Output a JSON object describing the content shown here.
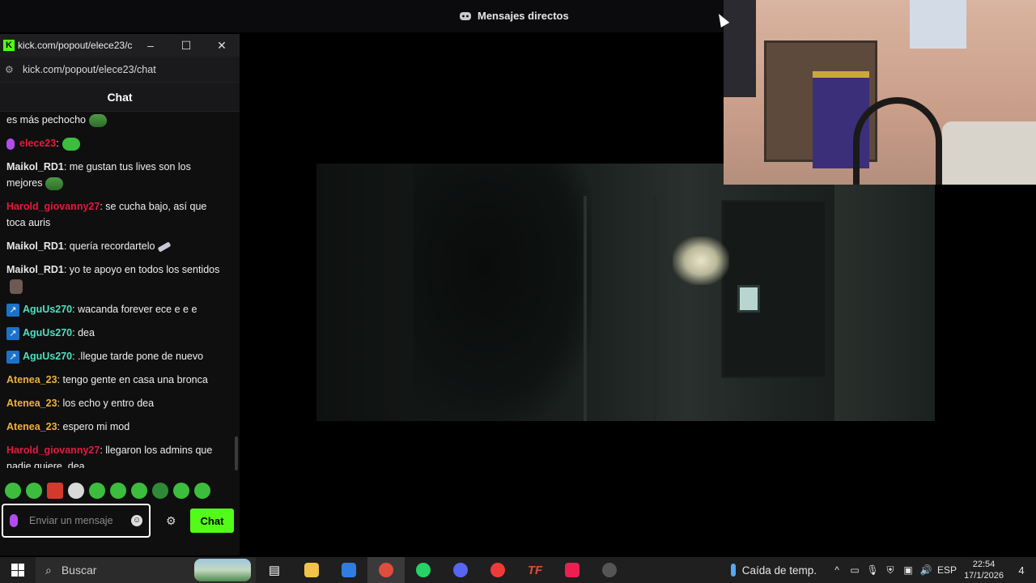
{
  "discord": {
    "title": "Mensajes directos"
  },
  "popout": {
    "window_title": "kick.com/popout/elece23/c...",
    "url": "kick.com/popout/elece23/chat",
    "header": "Chat",
    "messages": [
      {
        "user": "",
        "text": "es más pechocho",
        "color": "#f0f0f0",
        "emote": "frog"
      },
      {
        "user": "elece23",
        "text": "",
        "color": "#e5193c",
        "badge": "mic",
        "emote": "green"
      },
      {
        "user": "Maikol_RD1",
        "text": ": me gustan tus lives son los mejores",
        "color": "#e9e9e9",
        "emote": "frog"
      },
      {
        "user": "Harold_giovanny27",
        "text": ": se cucha bajo, así que toca auris",
        "color": "#e5193c"
      },
      {
        "user": "Maikol_RD1",
        "text": ": quería recordartelo",
        "color": "#e9e9e9",
        "emote": "bat"
      },
      {
        "user": "Maikol_RD1",
        "text": ": yo te apoyo en todos los sentidos",
        "color": "#e9e9e9",
        "emote": "person"
      },
      {
        "user": "AguUs270",
        "text": ": wacanda forever ece e e e",
        "color": "#4fe0c0",
        "badge": "sub"
      },
      {
        "user": "AguUs270",
        "text": ": dea",
        "color": "#4fe0c0",
        "badge": "sub"
      },
      {
        "user": "AguUs270",
        "text": ": .llegue tarde pone de nuevo",
        "color": "#4fe0c0",
        "badge": "sub"
      },
      {
        "user": "Atenea_23",
        "text": ": tengo gente en casa una bronca",
        "color": "#f0b23c"
      },
      {
        "user": "Atenea_23",
        "text": ": los echo y entro dea",
        "color": "#f0b23c"
      },
      {
        "user": "Atenea_23",
        "text": ": espero mi mod",
        "color": "#f0b23c"
      },
      {
        "user": "Harold_giovanny27",
        "text": ": llegaron los admins que nadie quiere. dea",
        "color": "#e5193c"
      }
    ],
    "input_placeholder": "Enviar un mensaje",
    "send_label": "Chat",
    "accent": "#53fc18"
  },
  "taskbar": {
    "search_placeholder": "Buscar",
    "weather": "Caída de temp.",
    "language": "ESP",
    "time": "22:54",
    "date": "17/1/2026",
    "notifications": "4"
  }
}
